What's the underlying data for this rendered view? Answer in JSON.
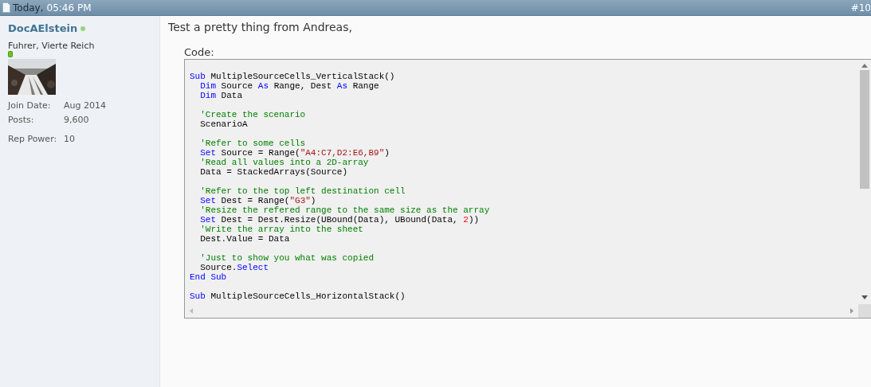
{
  "post_header": {
    "date": "Today,",
    "time": "05:46 PM",
    "post_number": "#10"
  },
  "user": {
    "name": "DocAElstein",
    "online": true,
    "title": "Fuhrer, Vierte Reich",
    "stats": [
      {
        "label": "Join Date:",
        "value": "Aug 2014"
      },
      {
        "label": "Posts:",
        "value": "9,600"
      },
      {
        "label": "Rep Power:",
        "value": "10"
      }
    ]
  },
  "message": "Test a pretty thing from Andreas,",
  "code": {
    "label": "Code:",
    "blocks": [
      [
        [
          {
            "kind": "keyword",
            "text": "Sub"
          },
          {
            "kind": "plain",
            "text": " MultipleSourceCells_VerticalStack()"
          }
        ],
        [
          {
            "kind": "keyword",
            "text": "  Dim"
          },
          {
            "kind": "plain",
            "text": " Source "
          },
          {
            "kind": "keyword",
            "text": "As"
          },
          {
            "kind": "plain",
            "text": " Range, Dest "
          },
          {
            "kind": "keyword",
            "text": "As"
          },
          {
            "kind": "plain",
            "text": " Range"
          }
        ],
        [
          {
            "kind": "keyword",
            "text": "  Dim"
          },
          {
            "kind": "plain",
            "text": " Data"
          }
        ]
      ],
      [
        [
          {
            "kind": "comment",
            "text": "  'Create the scenario"
          }
        ],
        [
          {
            "kind": "plain",
            "text": "  ScenarioA"
          }
        ]
      ],
      [
        [
          {
            "kind": "comment",
            "text": "  'Refer to some cells"
          }
        ],
        [
          {
            "kind": "keyword",
            "text": "  Set"
          },
          {
            "kind": "plain",
            "text": " Source = Range("
          },
          {
            "kind": "string",
            "text": "\"A4:C7,D2:E6,B9\""
          },
          {
            "kind": "plain",
            "text": ")"
          }
        ],
        [
          {
            "kind": "comment",
            "text": "  'Read all values into a 2D-array"
          }
        ],
        [
          {
            "kind": "plain",
            "text": "  Data = StackedArrays(Source)"
          }
        ]
      ],
      [
        [
          {
            "kind": "comment",
            "text": "  'Refer to the top left destination cell"
          }
        ],
        [
          {
            "kind": "keyword",
            "text": "  Set"
          },
          {
            "kind": "plain",
            "text": " Dest = Range("
          },
          {
            "kind": "string",
            "text": "\"G3\""
          },
          {
            "kind": "plain",
            "text": ")"
          }
        ],
        [
          {
            "kind": "comment",
            "text": "  'Resize the refered range to the same size as the array"
          }
        ],
        [
          {
            "kind": "keyword",
            "text": "  Set"
          },
          {
            "kind": "plain",
            "text": " Dest = Dest.Resize(UBound(Data), UBound(Data, "
          },
          {
            "kind": "number",
            "text": "2"
          },
          {
            "kind": "plain",
            "text": "))"
          }
        ],
        [
          {
            "kind": "comment",
            "text": "  'Write the array into the sheet"
          }
        ],
        [
          {
            "kind": "plain",
            "text": "  Dest.Value = Data"
          }
        ]
      ],
      [
        [
          {
            "kind": "comment",
            "text": "  'Just to show you what was copied"
          }
        ],
        [
          {
            "kind": "plain",
            "text": "  Source."
          },
          {
            "kind": "keyword",
            "text": "Select"
          }
        ],
        [
          {
            "kind": "keyword",
            "text": "End Sub"
          }
        ]
      ],
      [
        [
          {
            "kind": "keyword",
            "text": "Sub"
          },
          {
            "kind": "plain",
            "text": " MultipleSourceCells_HorizontalStack()"
          }
        ]
      ]
    ]
  }
}
